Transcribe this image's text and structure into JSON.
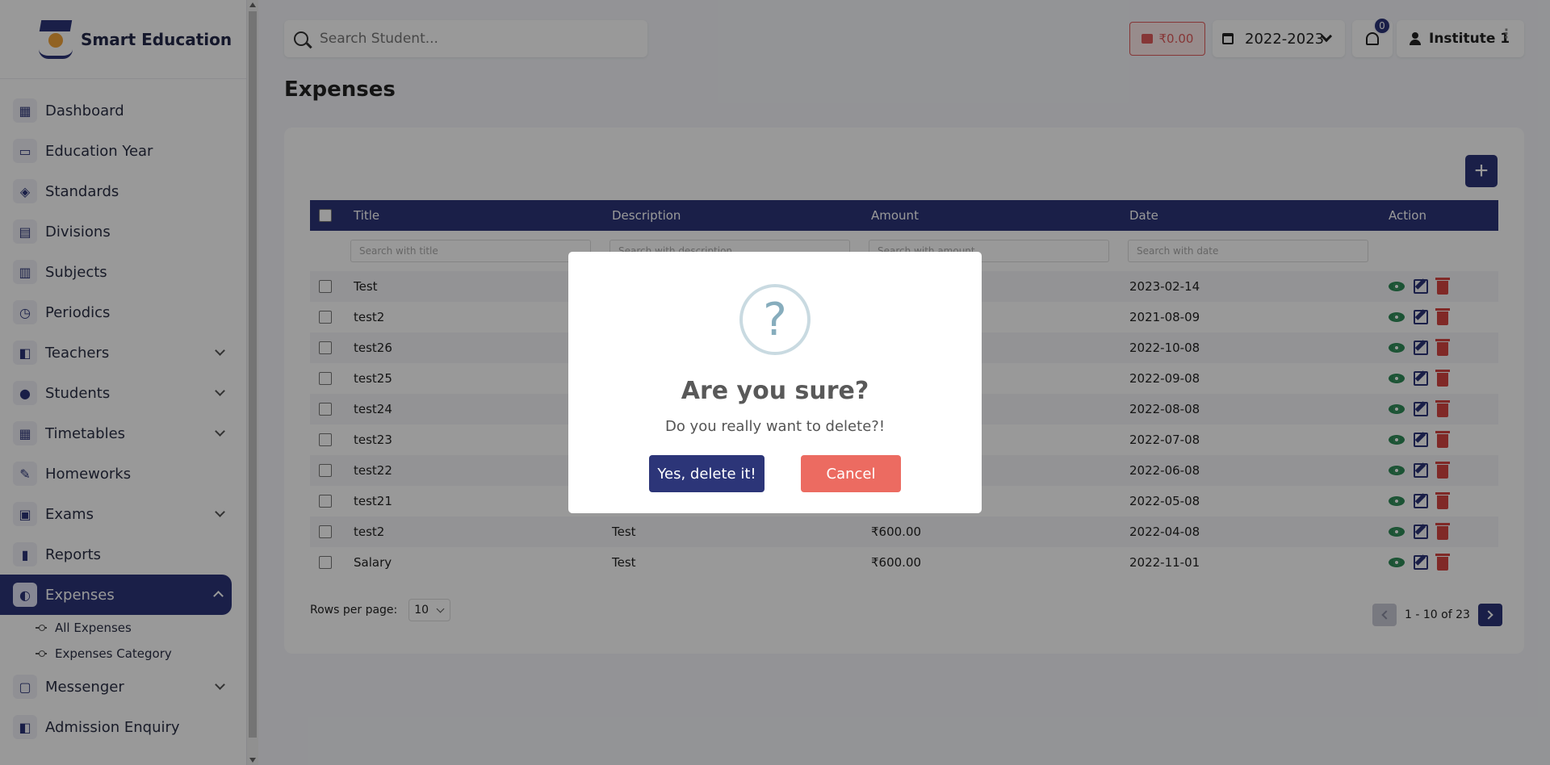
{
  "brand": {
    "name": "Smart Education"
  },
  "sidebar": {
    "items": [
      {
        "label": "Dashboard",
        "icon": "dashboard-icon",
        "glyph": "▦",
        "expandable": false
      },
      {
        "label": "Education Year",
        "icon": "calendar-icon",
        "glyph": "▭",
        "expandable": false
      },
      {
        "label": "Standards",
        "icon": "graduation-cap-icon",
        "glyph": "◈",
        "expandable": false
      },
      {
        "label": "Divisions",
        "icon": "blocks-icon",
        "glyph": "▤",
        "expandable": false
      },
      {
        "label": "Subjects",
        "icon": "books-icon",
        "glyph": "▥",
        "expandable": false
      },
      {
        "label": "Periodics",
        "icon": "schedule-icon",
        "glyph": "◷",
        "expandable": false
      },
      {
        "label": "Teachers",
        "icon": "teacher-icon",
        "glyph": "◧",
        "expandable": true
      },
      {
        "label": "Students",
        "icon": "students-icon",
        "glyph": "●",
        "expandable": true
      },
      {
        "label": "Timetables",
        "icon": "table-icon",
        "glyph": "▦",
        "expandable": true
      },
      {
        "label": "Homeworks",
        "icon": "homework-icon",
        "glyph": "✎",
        "expandable": false
      },
      {
        "label": "Exams",
        "icon": "clipboard-icon",
        "glyph": "▣",
        "expandable": true
      },
      {
        "label": "Reports",
        "icon": "bar-chart-icon",
        "glyph": "▮",
        "expandable": false
      },
      {
        "label": "Expenses",
        "icon": "expenses-icon",
        "glyph": "◐",
        "expandable": true,
        "active": true
      },
      {
        "label": "Messenger",
        "icon": "message-icon",
        "glyph": "▢",
        "expandable": true
      },
      {
        "label": "Admission Enquiry",
        "icon": "enquiry-icon",
        "glyph": "◧",
        "expandable": false
      }
    ],
    "expenses_sub": [
      "All Expenses",
      "Expenses Category"
    ]
  },
  "header": {
    "search_placeholder": "Search Student...",
    "wallet": "₹0.00",
    "year": "2022-2023",
    "notifications": "0",
    "user": "Institute 1"
  },
  "page": {
    "title": "Expenses"
  },
  "table": {
    "columns": [
      "Title",
      "Description",
      "Amount",
      "Date",
      "Action"
    ],
    "filters": [
      "Search with title",
      "Search with description",
      "Search with amount",
      "Search with date"
    ],
    "rows": [
      {
        "title": "Test",
        "description": "",
        "amount": "",
        "date": "2023-02-14"
      },
      {
        "title": "test2",
        "description": "",
        "amount": "",
        "date": "2021-08-09"
      },
      {
        "title": "test26",
        "description": "",
        "amount": "",
        "date": "2022-10-08"
      },
      {
        "title": "test25",
        "description": "",
        "amount": "",
        "date": "2022-09-08"
      },
      {
        "title": "test24",
        "description": "",
        "amount": "",
        "date": "2022-08-08"
      },
      {
        "title": "test23",
        "description": "",
        "amount": "",
        "date": "2022-07-08"
      },
      {
        "title": "test22",
        "description": "",
        "amount": "",
        "date": "2022-06-08"
      },
      {
        "title": "test21",
        "description": "",
        "amount": "",
        "date": "2022-05-08"
      },
      {
        "title": "test2",
        "description": "Test",
        "amount": "₹600.00",
        "date": "2022-04-08"
      },
      {
        "title": "Salary",
        "description": "Test",
        "amount": "₹600.00",
        "date": "2022-11-01"
      }
    ]
  },
  "pagination": {
    "rows_label": "Rows per page:",
    "rows_value": "10",
    "range": "1 - 10 of 23"
  },
  "modal": {
    "icon": "?",
    "title": "Are you sure?",
    "text": "Do you really want to delete?!",
    "confirm": "Yes, delete it!",
    "cancel": "Cancel"
  },
  "colors": {
    "primary": "#2c3578",
    "danger": "#ec6b61",
    "view": "#2e8b57",
    "delete": "#d64541"
  }
}
